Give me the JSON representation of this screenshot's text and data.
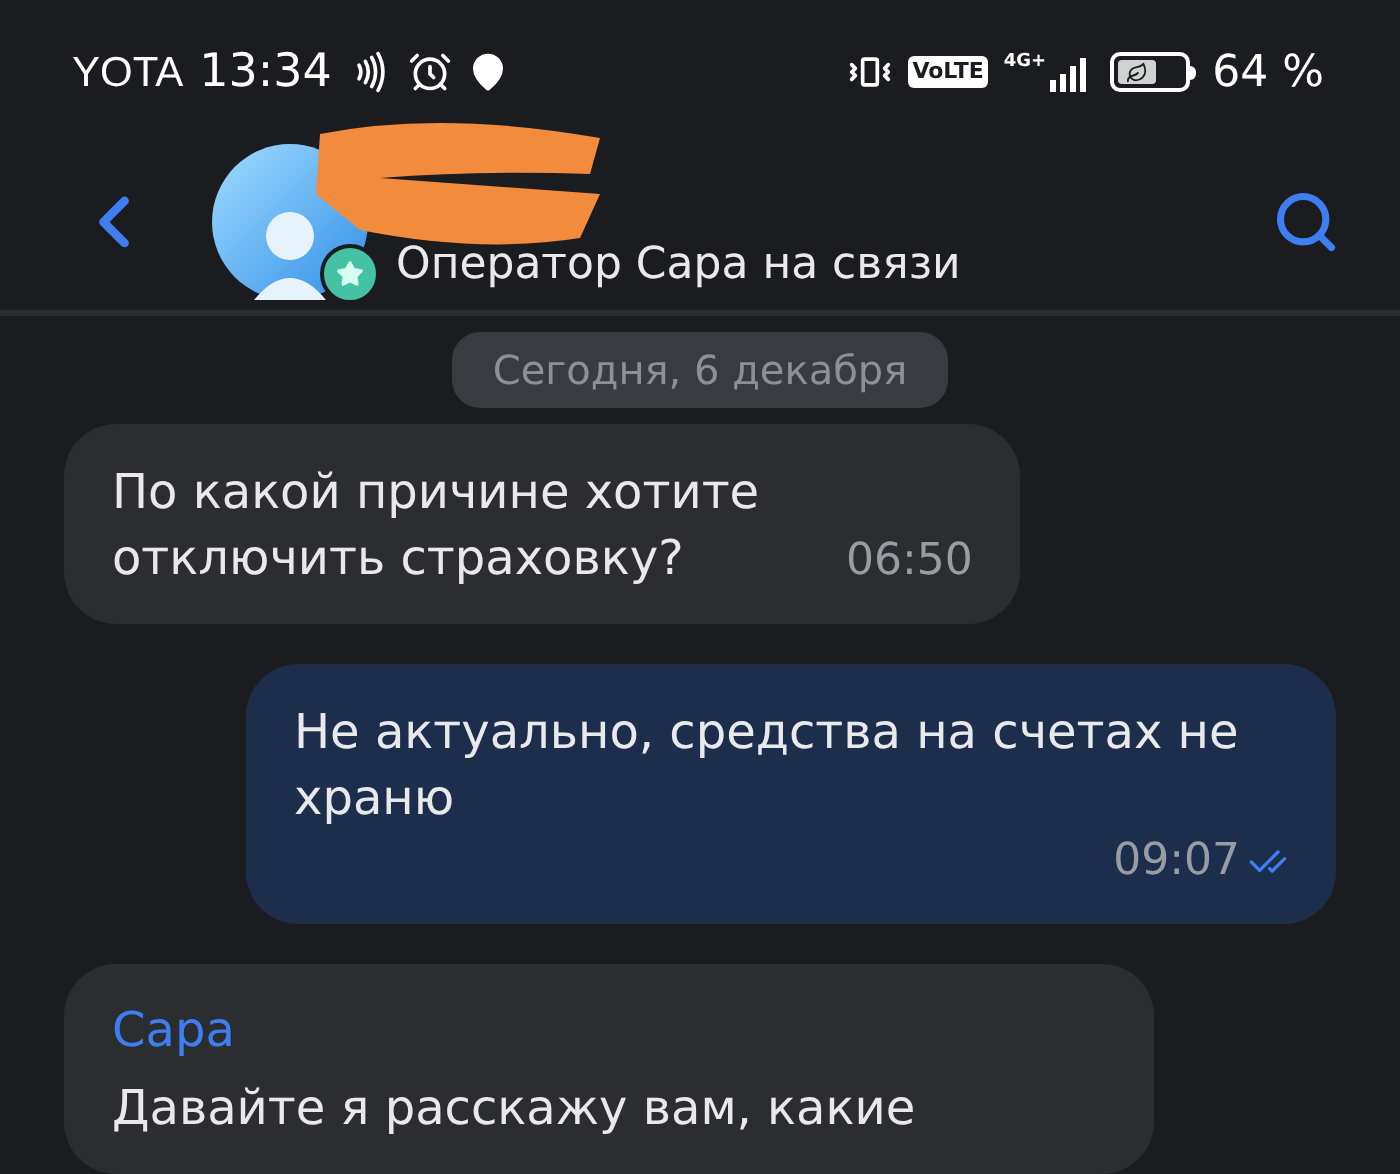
{
  "status_bar": {
    "carrier": "YOTA",
    "time": "13:34",
    "network": "VoLTE",
    "network_type": "4G+",
    "battery": "64 %"
  },
  "header": {
    "subtitle": "Оператор Сара на связи"
  },
  "date_badge": "Сегодня, 6 декабря",
  "messages": [
    {
      "kind": "incoming",
      "text": "По какой причине хотите отключить страховку?",
      "time": "06:50"
    },
    {
      "kind": "outgoing",
      "text": "Не актуально, средства на счетах не храню",
      "time": "09:07",
      "read": true
    },
    {
      "kind": "incoming",
      "sender": "Сара",
      "text": "Давайте я расскажу вам, какие"
    }
  ]
}
